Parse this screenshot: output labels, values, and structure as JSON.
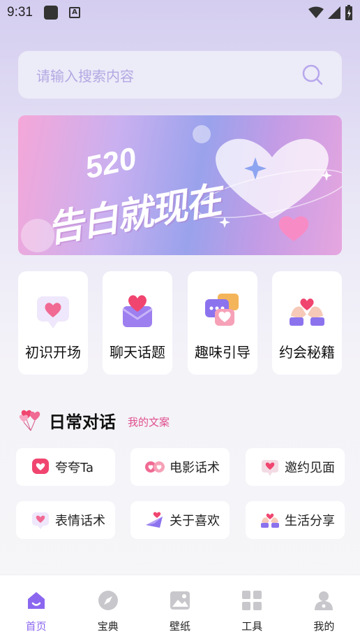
{
  "status_bar": {
    "time": "9:31"
  },
  "search": {
    "placeholder": "请输入搜索内容"
  },
  "banner": {
    "number": "520",
    "title": "告白就现在"
  },
  "categories": [
    {
      "label": "初识开场",
      "icon": "heart-chat-icon"
    },
    {
      "label": "聊天话题",
      "icon": "heart-envelope-icon"
    },
    {
      "label": "趣味引导",
      "icon": "chat-bubbles-icon"
    },
    {
      "label": "约会秘籍",
      "icon": "hands-heart-icon"
    }
  ],
  "section": {
    "title": "日常对话",
    "subtitle": "我的文案"
  },
  "pills": [
    {
      "label": "夸夸Ta",
      "icon": "heart-balloon-icon"
    },
    {
      "label": "电影话术",
      "icon": "film-hearts-icon"
    },
    {
      "label": "邀约见面",
      "icon": "invite-heart-icon"
    },
    {
      "label": "表情话术",
      "icon": "heart-chat-icon"
    },
    {
      "label": "关于喜欢",
      "icon": "love-letter-icon"
    },
    {
      "label": "生活分享",
      "icon": "hands-heart-icon"
    }
  ],
  "nav": {
    "active": "首页",
    "items": [
      {
        "label": "首页",
        "icon": "home-icon"
      },
      {
        "label": "宝典",
        "icon": "compass-icon"
      },
      {
        "label": "壁纸",
        "icon": "wallpaper-icon"
      },
      {
        "label": "工具",
        "icon": "grid-icon"
      },
      {
        "label": "我的",
        "icon": "profile-icon"
      }
    ]
  },
  "colors": {
    "accent": "#8b67f0",
    "pink": "#e0508f",
    "search_text": "#b2a9e3"
  }
}
